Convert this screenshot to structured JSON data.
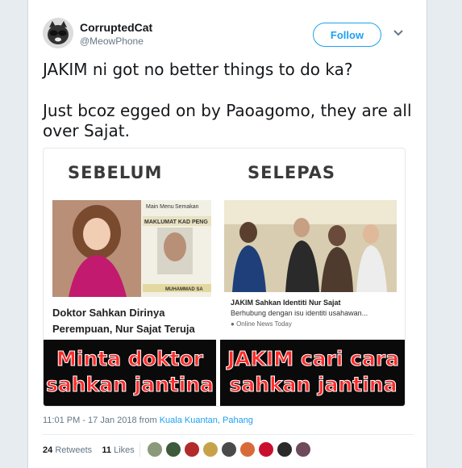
{
  "tweet": {
    "display_name": "CorruptedCat",
    "handle": "@MeowPhone",
    "follow_label": "Follow",
    "text_line1": "JAKIM ni got no better things to do ka?",
    "text_line2": "Just bcoz egged on by Paoagomo, they are all over Sajat.",
    "timestamp": "11:01 PM - 17 Jan 2018 from",
    "location": "Kuala Kuantan, Pahang",
    "retweets_count": "24",
    "retweets_label": "Retweets",
    "likes_count": "11",
    "likes_label": "Likes"
  },
  "media": {
    "left_header": "SEBELUM",
    "right_header": "SELEPAS",
    "left_caption_line1": "Doktor Sahkan Dirinya",
    "left_caption_line2": "Perempuan, Nur Sajat Teruja",
    "right_caption_title": "JAKIM Sahkan Identiti Nur Sajat",
    "right_caption_sub": "Berhubung dengan isu identiti usahawan...",
    "right_caption_source": "Online News Today",
    "left_banner_line1": "Minta doktor",
    "left_banner_line2": "sahkan jantina",
    "right_banner_line1": "JAKIM cari cara",
    "right_banner_line2": "sahkan jantina",
    "left_photo_text_1": "Main Menu",
    "left_photo_text_2": "Semakan",
    "left_photo_text_3": "MAKLUMAT KAD PENG",
    "left_photo_text_4": "MUHAMMAD SA"
  },
  "colors": {
    "accent": "#1da1f2",
    "banner_text": "#ff2a2a",
    "banner_bg": "#0a0a0a"
  }
}
